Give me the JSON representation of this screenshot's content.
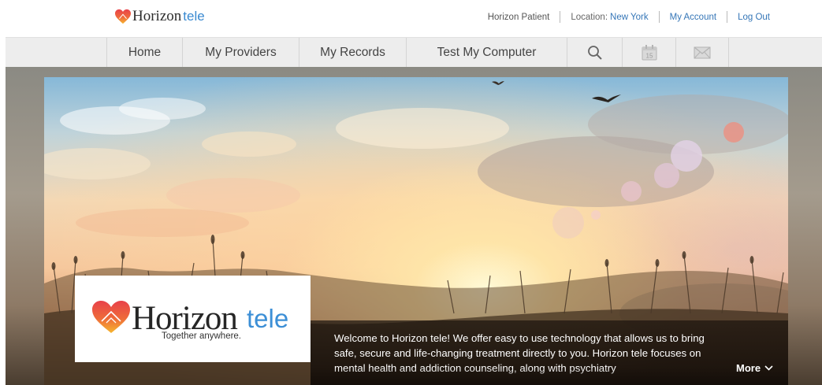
{
  "brand": {
    "name_a": "Horizon",
    "name_b": "tele",
    "tagline": "Together anywhere."
  },
  "top_links": {
    "patient": "Horizon Patient",
    "location_label": "Location:",
    "location_value": "New York",
    "account": "My Account",
    "logout": "Log Out"
  },
  "nav": {
    "items": [
      {
        "label": "Home"
      },
      {
        "label": "My Providers"
      },
      {
        "label": "My Records"
      },
      {
        "label": "Test My Computer"
      }
    ],
    "icons": [
      "search-icon",
      "calendar-icon",
      "mail-icon"
    ],
    "calendar_day": "15"
  },
  "hero": {
    "welcome_text": "Welcome to Horizon tele! We offer easy to use technology that allows us to bring safe, secure and life-changing treatment directly to you. Horizon tele focuses on mental health and addiction counseling, along with psychiatry",
    "more_label": "More"
  },
  "colors": {
    "brand_blue": "#3c8fd6",
    "link_blue": "#3576b7",
    "nav_bg": "#ededed",
    "heart_red": "#e8414a",
    "heart_yellow": "#f6b52e"
  }
}
